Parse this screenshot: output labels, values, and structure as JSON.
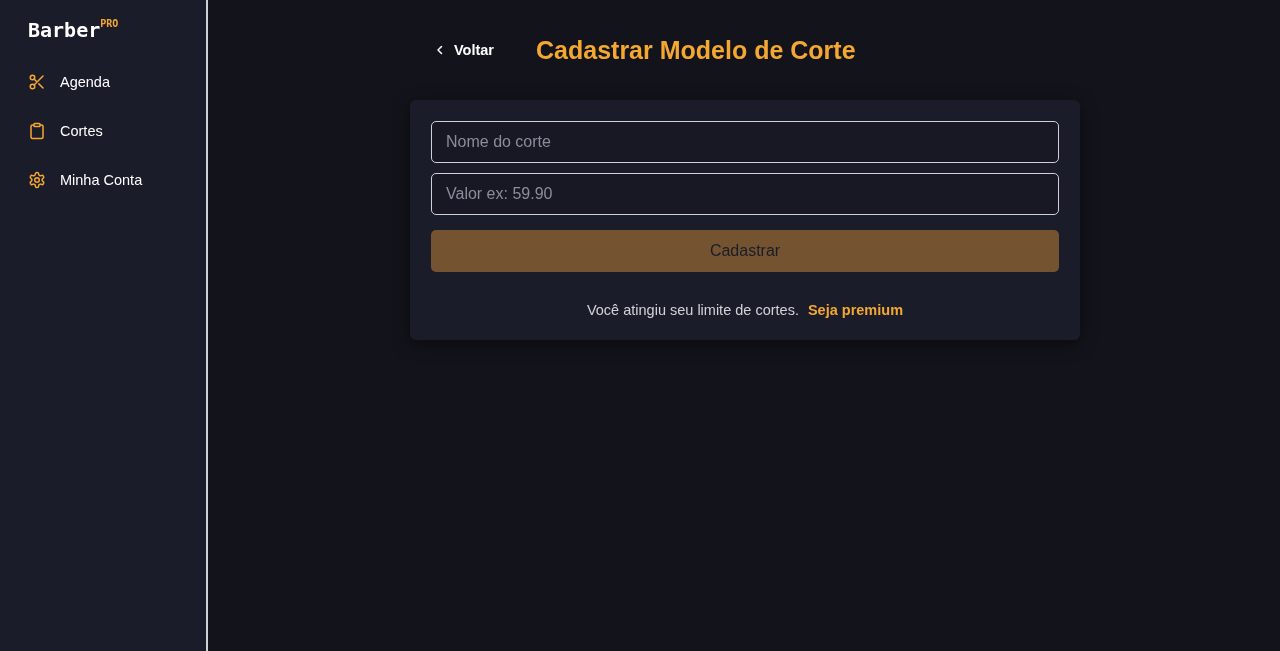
{
  "sidebar": {
    "logo": "Barber",
    "logo_badge": "PRO",
    "items": [
      {
        "label": "Agenda"
      },
      {
        "label": "Cortes"
      },
      {
        "label": "Minha Conta"
      }
    ]
  },
  "header": {
    "back": "Voltar",
    "title": "Cadastrar Modelo de Corte"
  },
  "form": {
    "fields": [
      {
        "placeholder": "Nome do corte"
      },
      {
        "placeholder": "Valor ex: 59.90"
      }
    ],
    "submit": {
      "label": "Cadastrar",
      "disabled": true
    },
    "notice": {
      "text": "Você atingiu seu limite de cortes.",
      "link": "Seja premium"
    }
  }
}
